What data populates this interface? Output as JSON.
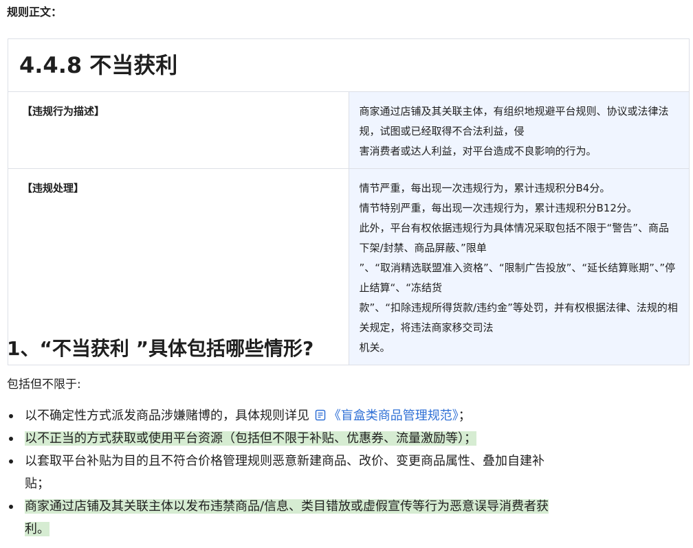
{
  "intro_label": "规则正文：",
  "rule": {
    "title": "4.4.8 不当获利",
    "rows": [
      {
        "label": "【违规行为描述】",
        "lines": [
          "商家通过店铺及其关联主体，有组织地规避平台规则、协议或法律法规，试图或已经取得不合法利益，侵",
          "害消费者或达人利益，对平台造成不良影响的行为。"
        ]
      },
      {
        "label": "【违规处理】",
        "lines": [
          "情节严重，每出现一次违规行为，累计违规积分B4分。",
          "情节特别严重，每出现一次违规行为，累计违规积分B12分。",
          "此外，平台有权依据违规行为具体情况采取包括不限于“警告”、商品下架/封禁、商品屏蔽、”限单",
          "”、“取消精选联盟准入资格”、“限制广告投放”、“延长结算账期”、”停止结算“、“冻结货",
          "款”、“扣除违规所得货款/违约金”等处罚，并有权根据法律、法规的相关规定，将违法商家移交司法",
          "机关。"
        ]
      }
    ]
  },
  "section": {
    "heading": "1、“不当获利 ”具体包括哪些情形?",
    "intro": "包括但不限于:",
    "bullets": [
      {
        "lines": [
          "以不确定性方式派发商品涉嫌赌博的，具体规则详见 "
        ],
        "link_text": "《盲盒类商品管理规范》",
        "suffix": "；",
        "highlight": false
      },
      {
        "lines": [
          "以不正当的方式获取或使用平台资源（包括但不限于补贴、优惠券、流量激励等）；"
        ],
        "highlight": true
      },
      {
        "lines": [
          "以套取平台补贴为目的且不符合价格管理规则恶意新建商品、改价、变更商品属性、叠加自建补",
          "贴；"
        ],
        "highlight": false
      },
      {
        "lines": [
          "商家通过店铺及其关联主体以发布违禁商品/信息、类目错放或虚假宣传等行为恶意误导消费者获",
          "利。"
        ],
        "highlight": true
      }
    ]
  },
  "colors": {
    "table_content_bg": "#f0f5ff",
    "highlight_bg": "#d6ecd2",
    "link": "#2e6fd6",
    "border": "#dcdfe6"
  },
  "icons": {
    "doc_link_icon": "document-icon"
  }
}
